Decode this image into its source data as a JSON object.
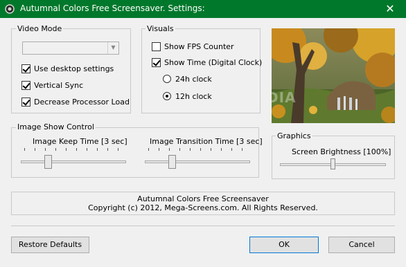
{
  "window": {
    "title": "Autumnal Colors Free Screensaver. Settings:",
    "close_glyph": "✕",
    "colors": {
      "titlebar": "#00782b",
      "background": "#f0f0f0"
    },
    "icons": {
      "app": "screensaver-gear-icon",
      "close": "close-icon"
    }
  },
  "video_mode": {
    "group_label": "Video Mode",
    "dropdown_value": "",
    "dropdown_enabled": false,
    "options": [
      {
        "label": "Use desktop settings",
        "checked": true
      },
      {
        "label": "Vertical Sync",
        "checked": true
      },
      {
        "label": "Decrease Processor Load",
        "checked": true
      }
    ]
  },
  "visuals": {
    "group_label": "Visuals",
    "show_fps": {
      "label": "Show FPS Counter",
      "checked": false
    },
    "show_time": {
      "label": "Show Time (Digital Clock)",
      "checked": true
    },
    "clock_24h": {
      "label": "24h clock",
      "selected": false
    },
    "clock_12h": {
      "label": "12h clock",
      "selected": true
    }
  },
  "preview": {
    "watermark": "SOFTPEDIA"
  },
  "image_show": {
    "group_label": "Image Show Control",
    "keep_time": {
      "label": "Image Keep Time [3 sec]",
      "level": 0.24
    },
    "transition_time": {
      "label": "Image Transition Time [3 sec]",
      "level": 0.24
    }
  },
  "graphics": {
    "group_label": "Graphics",
    "brightness": {
      "label": "Screen Brightness [100%]",
      "level": 0.5
    }
  },
  "info": {
    "line1": "Autumnal Colors Free Screensaver",
    "line2": "Copyright (c) 2012, Mega-Screens.com. All Rights Reserved."
  },
  "buttons": {
    "restore_defaults": "Restore Defaults",
    "ok": "OK",
    "cancel": "Cancel"
  }
}
